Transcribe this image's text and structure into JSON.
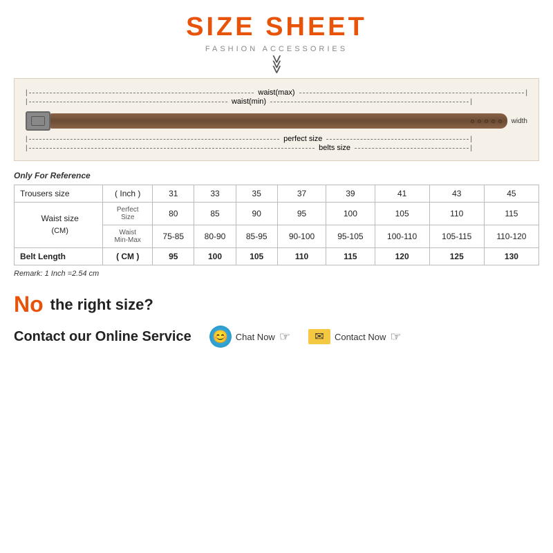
{
  "header": {
    "title": "SIZE SHEET",
    "subtitle": "FASHION ACCESSORIES"
  },
  "belt_diagram": {
    "waist_max_label": "waist(max)",
    "waist_min_label": "waist(min)",
    "perfect_size_label": "perfect size",
    "belts_size_label": "belts size",
    "width_label": "width"
  },
  "table": {
    "only_ref": "Only For Reference",
    "remark": "Remark: 1 Inch =2.54 cm",
    "columns": [
      "Trousers size",
      "( Inch )",
      "31",
      "33",
      "35",
      "37",
      "39",
      "41",
      "43",
      "45"
    ],
    "waist_label": "Waist size\n( CM )",
    "perfect_size_label": "Perfect\nSize",
    "waist_minmax_label": "Waist\nMin-Max",
    "belt_length_label": "Belt Length",
    "belt_length_unit": "( CM )",
    "perfect_size_values": [
      "80",
      "85",
      "90",
      "95",
      "100",
      "105",
      "110",
      "115"
    ],
    "waist_minmax_values": [
      "75-85",
      "80-90",
      "85-95",
      "90-100",
      "95-105",
      "100-110",
      "105-115",
      "110-120"
    ],
    "belt_length_values": [
      "95",
      "100",
      "105",
      "110",
      "115",
      "120",
      "125",
      "130"
    ]
  },
  "bottom": {
    "no_text": "No",
    "no_size_text": "the right size?",
    "contact_label": "Contact our Online Service",
    "chat_now": "Chat Now",
    "contact_now": "Contact Now"
  }
}
